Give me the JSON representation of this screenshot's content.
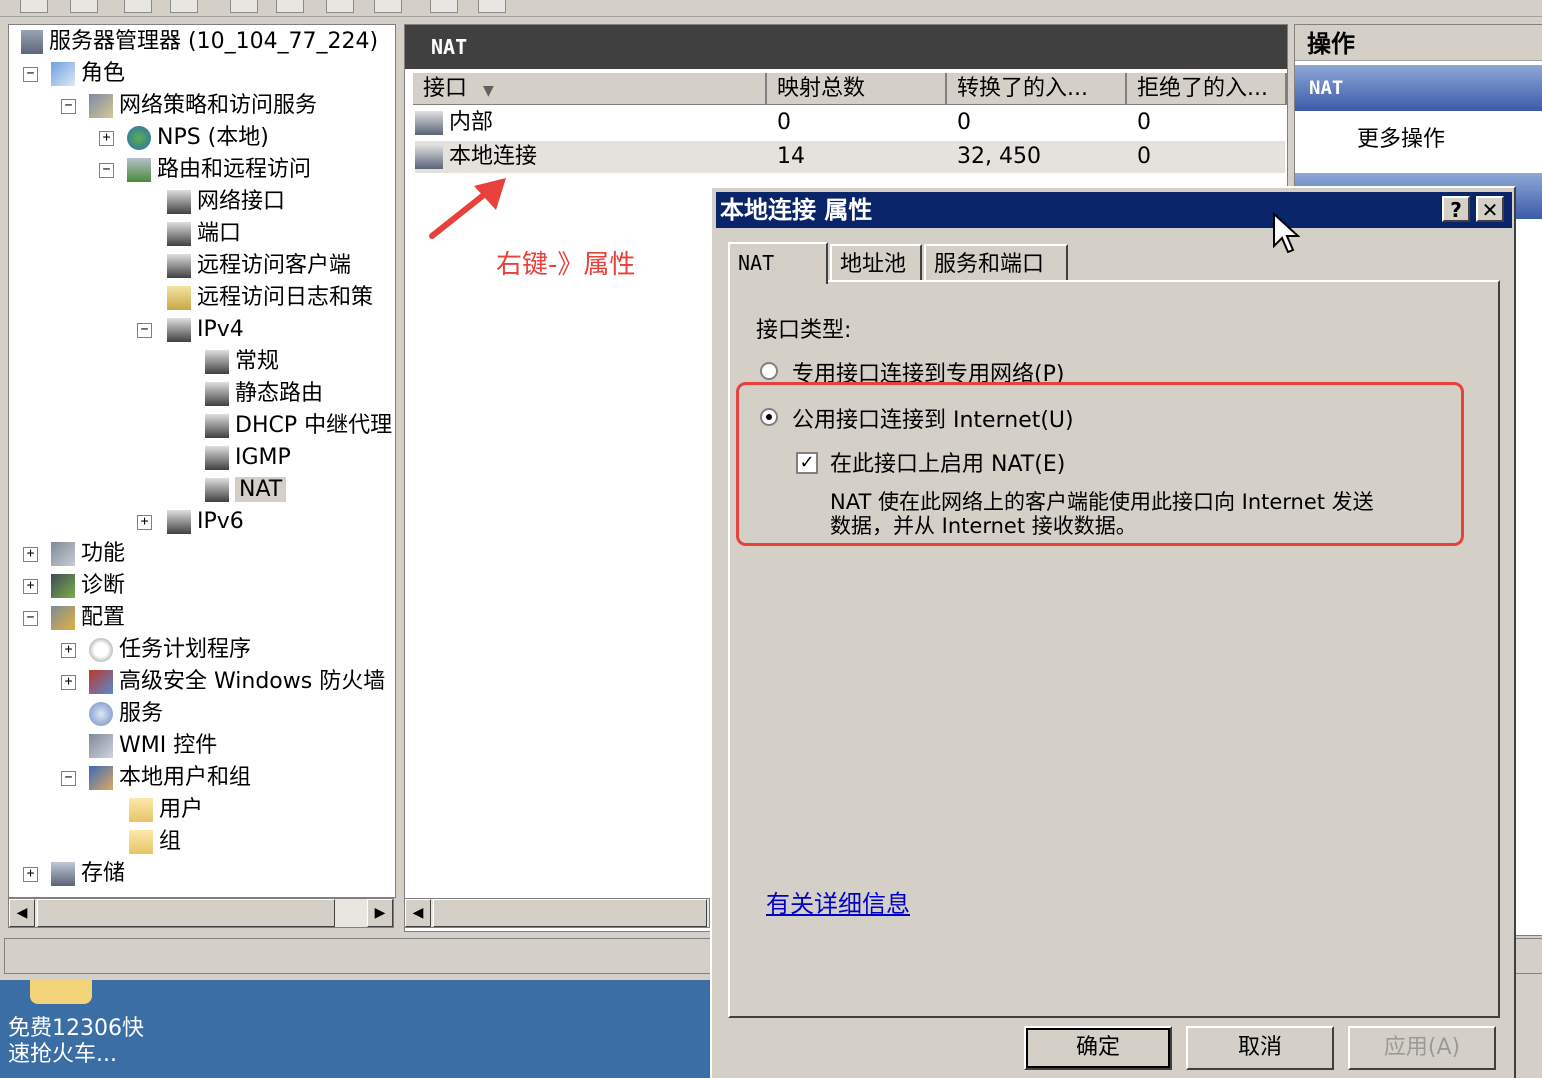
{
  "tree": {
    "root": "服务器管理器 (10_104_77_224)",
    "items": [
      {
        "label": "角色"
      },
      {
        "label": "网络策略和访问服务"
      },
      {
        "label": "NPS (本地)"
      },
      {
        "label": "路由和远程访问"
      },
      {
        "label": "网络接口"
      },
      {
        "label": "端口"
      },
      {
        "label": "远程访问客户端"
      },
      {
        "label": "远程访问日志和策"
      },
      {
        "label": "IPv4"
      },
      {
        "label": "常规"
      },
      {
        "label": "静态路由"
      },
      {
        "label": "DHCP 中继代理"
      },
      {
        "label": "IGMP"
      },
      {
        "label": "NAT"
      },
      {
        "label": "IPv6"
      },
      {
        "label": "功能"
      },
      {
        "label": "诊断"
      },
      {
        "label": "配置"
      },
      {
        "label": "任务计划程序"
      },
      {
        "label": "高级安全 Windows 防火墙"
      },
      {
        "label": "服务"
      },
      {
        "label": "WMI 控件"
      },
      {
        "label": "本地用户和组"
      },
      {
        "label": "用户"
      },
      {
        "label": "组"
      },
      {
        "label": "存储"
      }
    ]
  },
  "middle": {
    "title": "NAT",
    "columns": [
      "接口",
      "映射总数",
      "转换了的入...",
      "拒绝了的入..."
    ],
    "rows": [
      {
        "name": "内部",
        "mappings": "0",
        "translated": "0",
        "rejected": "0"
      },
      {
        "name": "本地连接",
        "mappings": "14",
        "translated": "32, 450",
        "rejected": "0"
      }
    ],
    "annotation": "右键-》属性"
  },
  "actions": {
    "title": "操作",
    "section": "NAT",
    "more": "更多操作"
  },
  "dialog": {
    "title": "本地连接 属性",
    "help": "?",
    "close": "✕",
    "tabs": [
      "NAT",
      "地址池",
      "服务和端口"
    ],
    "interface_type_label": "接口类型:",
    "radio_private": "专用接口连接到专用网络(P)",
    "radio_public": "公用接口连接到 Internet(U)",
    "checkbox_nat": "在此接口上启用 NAT(E)",
    "nat_desc_line1": "NAT 使在此网络上的客户端能使用此接口向 Internet 发送",
    "nat_desc_line2": "数据，并从 Internet 接收数据。",
    "link": "有关详细信息",
    "ok": "确定",
    "cancel": "取消",
    "apply": "应用(A)"
  },
  "taskbar": {
    "item_line1": "免费12306快",
    "item_line2": "速抢火车..."
  },
  "colors": {
    "annotation": "#e8403a",
    "dialog_title_bg": "#0a246a",
    "desktop": "#3a6ea5"
  }
}
